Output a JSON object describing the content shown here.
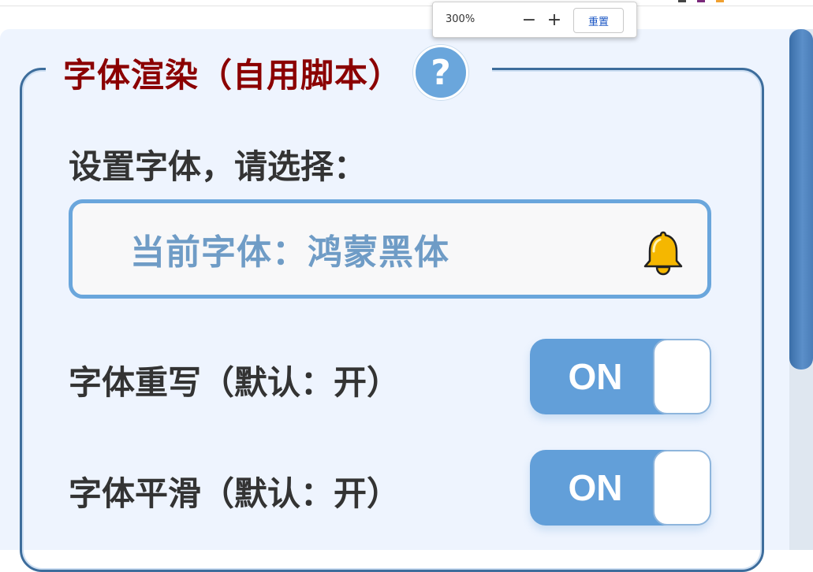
{
  "zoom": {
    "value": "300%",
    "minus": "−",
    "plus": "+",
    "reset": "重置"
  },
  "panel": {
    "title": "字体渲染（自用脚本）",
    "help_glyph": "?",
    "font_select_label": "设置字体，请选择：",
    "current_font": "当前字体：鸿蒙黑体",
    "settings": [
      {
        "label": "字体重写（默认：开）",
        "state": "ON"
      },
      {
        "label": "字体平滑（默认：开）",
        "state": "ON"
      }
    ]
  },
  "colors": {
    "title": "#8b0000",
    "accent": "#629fd9",
    "border": "#3d6d9c",
    "panel_bg": "#eef4fe",
    "bell": "#f5b700"
  },
  "icons": {
    "help": "question-circle-icon",
    "notify": "bell-icon"
  }
}
